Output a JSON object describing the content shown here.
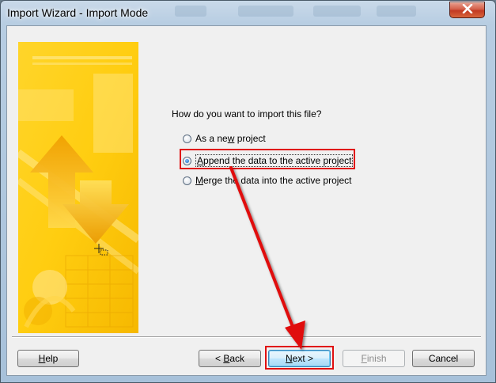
{
  "window": {
    "title": "Import Wizard - Import Mode"
  },
  "main": {
    "question": "How do you want to import this file?",
    "options": [
      {
        "pre": "As a ne",
        "accel": "w",
        "post": " project",
        "checked": false
      },
      {
        "pre": "",
        "accel": "A",
        "post": "ppend the data to the active project",
        "checked": true
      },
      {
        "pre": "",
        "accel": "M",
        "post": "erge the data into the active project",
        "checked": false
      }
    ]
  },
  "buttons": {
    "help": {
      "accel": "H",
      "post": "elp"
    },
    "back": {
      "pre": "< ",
      "accel": "B",
      "post": "ack"
    },
    "next": {
      "pre": "",
      "accel": "N",
      "post": "ext >"
    },
    "finish": {
      "accel": "F",
      "post": "inish"
    },
    "cancel": "Cancel"
  },
  "colors": {
    "annotation": "#e01010",
    "art_yellow": "#ffd21e",
    "art_orange": "#f4a400"
  },
  "icons": [
    "close-icon",
    "wizard-art",
    "annotation-arrow-icon"
  ]
}
